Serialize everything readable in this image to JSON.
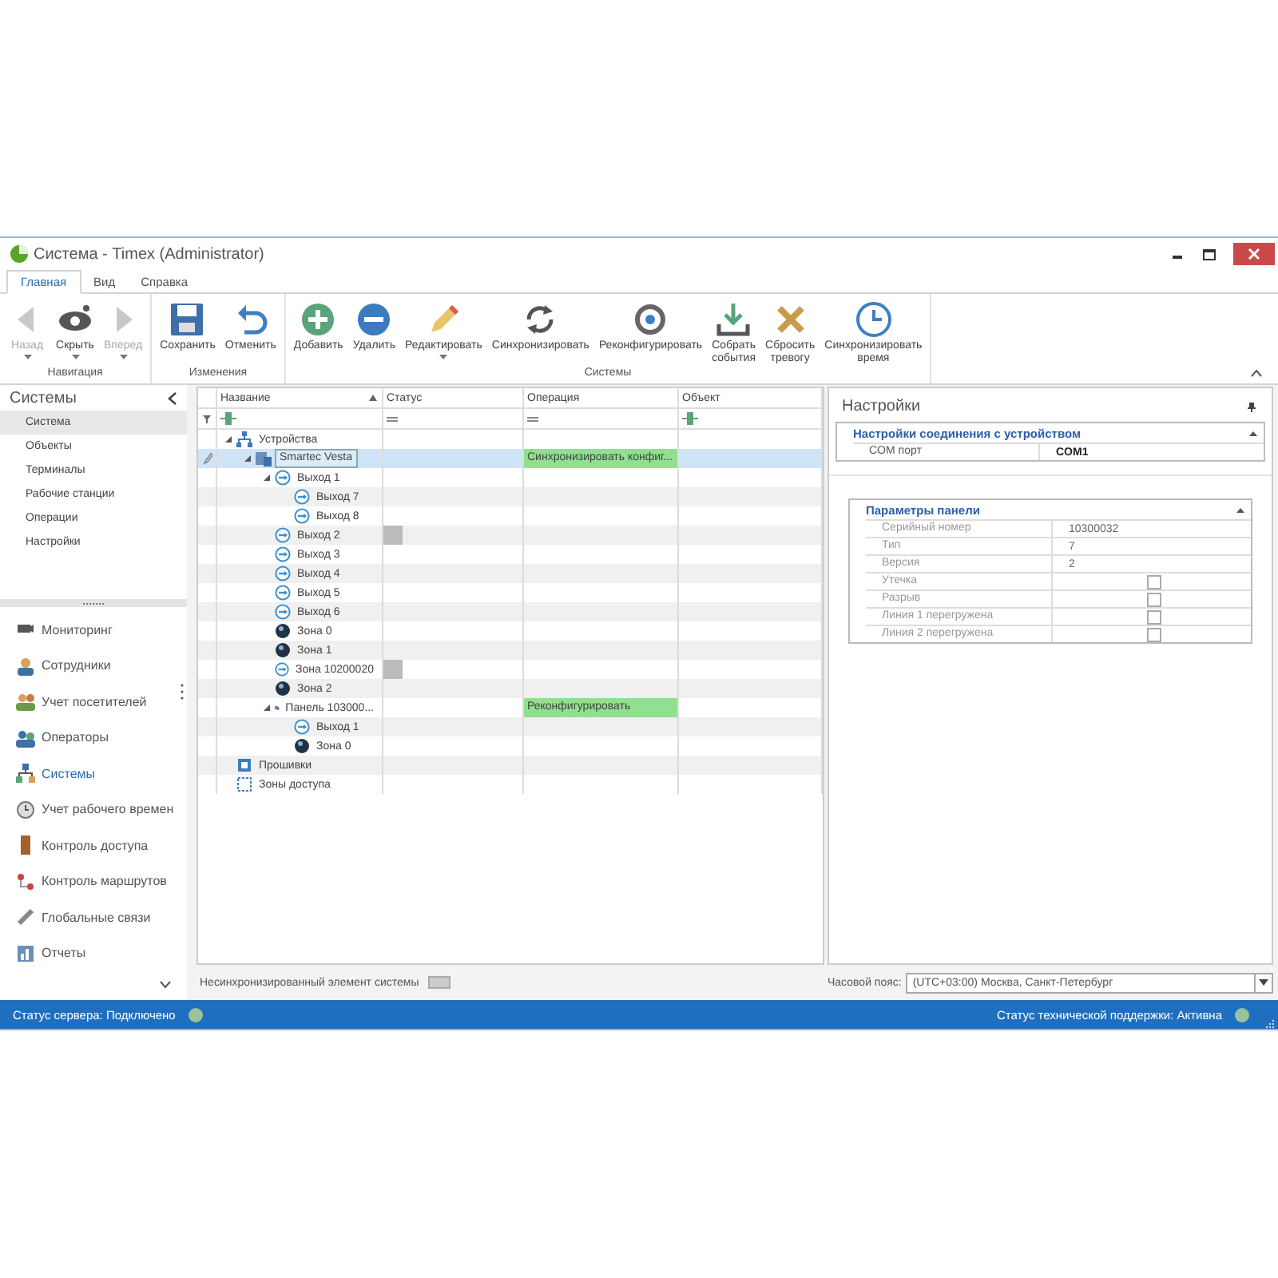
{
  "window": {
    "title": "Система - Timex (Administrator)"
  },
  "tabs": [
    {
      "label": "Главная",
      "selected": true
    },
    {
      "label": "Вид",
      "selected": false
    },
    {
      "label": "Справка",
      "selected": false
    }
  ],
  "ribbon_groups": [
    {
      "label": "Навигация",
      "buttons": [
        {
          "label": "Назад",
          "disabled": true,
          "dropdown": true
        },
        {
          "label": "Скрыть",
          "disabled": false,
          "dropdown": true
        },
        {
          "label": "Вперед",
          "disabled": true,
          "dropdown": true
        }
      ]
    },
    {
      "label": "Изменения",
      "buttons": [
        {
          "label": "Сохранить",
          "disabled": false,
          "dropdown": false
        },
        {
          "label": "Отменить",
          "disabled": false,
          "dropdown": false
        }
      ]
    },
    {
      "label": "Системы",
      "buttons": [
        {
          "label": "Добавить",
          "disabled": false,
          "dropdown": false
        },
        {
          "label": "Удалить",
          "disabled": false,
          "dropdown": false
        },
        {
          "label": "Редактировать",
          "disabled": false,
          "dropdown": true
        },
        {
          "label": "Синхронизировать",
          "disabled": false,
          "dropdown": false
        },
        {
          "label": "Реконфигурировать",
          "disabled": false,
          "dropdown": false
        },
        {
          "label": "Собрать\nсобытия",
          "disabled": false,
          "dropdown": false
        },
        {
          "label": "Сбросить\nтревогу",
          "disabled": false,
          "dropdown": false
        },
        {
          "label": "Синхронизировать\nвремя",
          "disabled": false,
          "dropdown": false
        }
      ]
    }
  ],
  "sidebar": {
    "title": "Системы",
    "items": [
      {
        "label": "Система",
        "selected": true
      },
      {
        "label": "Объекты",
        "selected": false
      },
      {
        "label": "Терминалы",
        "selected": false
      },
      {
        "label": "Рабочие станции",
        "selected": false
      },
      {
        "label": "Операции",
        "selected": false
      },
      {
        "label": "Настройки",
        "selected": false
      }
    ],
    "modules": [
      {
        "label": "Мониторинг",
        "selected": false
      },
      {
        "label": "Сотрудники",
        "selected": false
      },
      {
        "label": "Учет посетителей",
        "selected": false
      },
      {
        "label": "Операторы",
        "selected": false
      },
      {
        "label": "Системы",
        "selected": true
      },
      {
        "label": "Учет рабочего времен",
        "selected": false
      },
      {
        "label": "Контроль доступа",
        "selected": false
      },
      {
        "label": "Контроль маршрутов",
        "selected": false
      },
      {
        "label": "Глобальные связи",
        "selected": false
      },
      {
        "label": "Отчеты",
        "selected": false
      }
    ]
  },
  "table": {
    "columns": [
      "Название",
      "Статус",
      "Операция",
      "Объект"
    ],
    "rows": [
      {
        "name": "Устройства",
        "kind": "group",
        "expanded": true,
        "selected": false,
        "unsynced": false,
        "children": [
          {
            "name": "Smartec Vesta",
            "kind": "panel",
            "expanded": true,
            "selected": true,
            "unsynced": false,
            "operation": "Синхронизировать конфиг...",
            "children": [
              {
                "name": "Выход 1",
                "kind": "output",
                "expanded": true,
                "selected": false,
                "unsynced": false,
                "children": [
                  {
                    "name": "Выход 7",
                    "kind": "output",
                    "selected": false,
                    "unsynced": false
                  },
                  {
                    "name": "Выход 8",
                    "kind": "output",
                    "selected": false,
                    "unsynced": false
                  }
                ]
              },
              {
                "name": "Выход 2",
                "kind": "output",
                "selected": false,
                "unsynced": true
              },
              {
                "name": "Выход 3",
                "kind": "output",
                "selected": false,
                "unsynced": false
              },
              {
                "name": "Выход 4",
                "kind": "output",
                "selected": false,
                "unsynced": false
              },
              {
                "name": "Выход 5",
                "kind": "output",
                "selected": false,
                "unsynced": false
              },
              {
                "name": "Выход 6",
                "kind": "output",
                "selected": false,
                "unsynced": false
              },
              {
                "name": "Зона 0",
                "kind": "zone",
                "selected": false,
                "unsynced": false
              },
              {
                "name": "Зона 1",
                "kind": "zone",
                "selected": false,
                "unsynced": false
              },
              {
                "name": "Зона 10200020",
                "kind": "output",
                "selected": false,
                "unsynced": true
              },
              {
                "name": "Зона 2",
                "kind": "zone",
                "selected": false,
                "unsynced": false
              },
              {
                "name": "Панель 103000...",
                "kind": "panel",
                "expanded": true,
                "selected": false,
                "unsynced": false,
                "operation": "Реконфигурировать",
                "children": [
                  {
                    "name": "Выход 1",
                    "kind": "output",
                    "selected": false,
                    "unsynced": false
                  },
                  {
                    "name": "Зона 0",
                    "kind": "zone",
                    "selected": false,
                    "unsynced": false
                  }
                ]
              }
            ]
          }
        ]
      },
      {
        "name": "Прошивки",
        "kind": "firmware",
        "selected": false,
        "unsynced": false
      },
      {
        "name": "Зоны доступа",
        "kind": "access_zones",
        "selected": false,
        "unsynced": false
      }
    ]
  },
  "legend": {
    "label": "Несинхронизированный элемент системы"
  },
  "settings": {
    "title": "Настройки",
    "sections": [
      {
        "title": "Настройки соединения с устройством",
        "expanded": true,
        "rows": [
          {
            "label": "COM порт",
            "value": "COM1",
            "kind": "text",
            "bold": true
          }
        ]
      },
      {
        "title": "Параметры панели",
        "expanded": true,
        "rows": [
          {
            "label": "Серийный номер",
            "value": "10300032",
            "kind": "text",
            "bold": false
          },
          {
            "label": "Тип",
            "value": "7",
            "kind": "text",
            "bold": false
          },
          {
            "label": "Версия",
            "value": "2",
            "kind": "text",
            "bold": false
          },
          {
            "label": "Утечка",
            "kind": "checkbox",
            "checked": false
          },
          {
            "label": "Разрыв",
            "kind": "checkbox",
            "checked": false
          },
          {
            "label": "Линия 1 перегружена",
            "kind": "checkbox",
            "checked": false
          },
          {
            "label": "Линия 2 перегружена",
            "kind": "checkbox",
            "checked": false
          }
        ]
      }
    ],
    "timezone_label": "Часовой пояс:",
    "timezone": "(UTC+03:00) Москва, Санкт-Петербург"
  },
  "status_bar": {
    "server": "Статус сервера: Подключено",
    "support": "Статус технической поддержки: Активна"
  }
}
